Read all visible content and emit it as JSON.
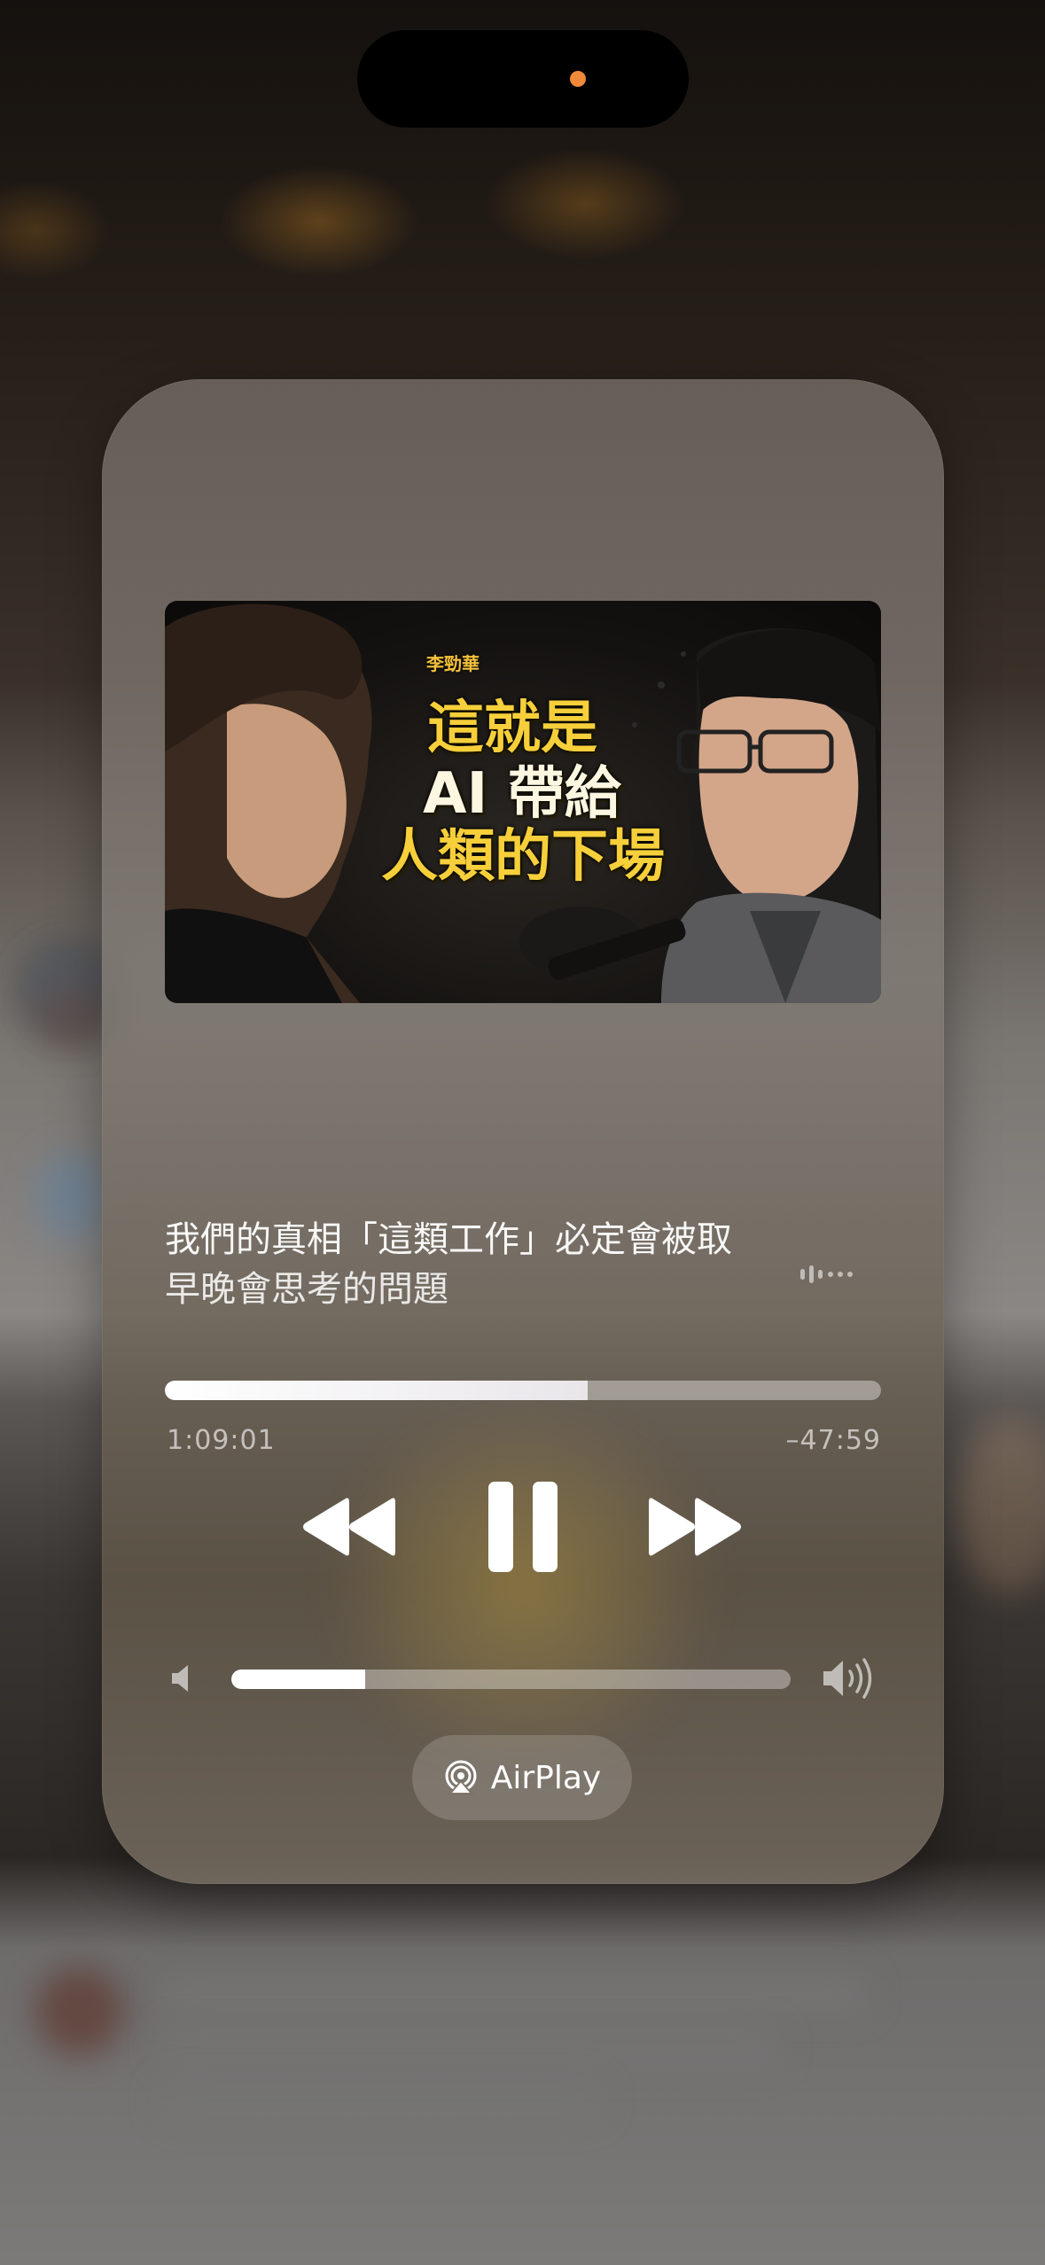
{
  "artwork": {
    "name_tag": "李勁華",
    "headline_line1": "這就是",
    "headline_line2": "AI 帶給",
    "headline_line3": "人類的下場"
  },
  "track": {
    "title": "我們的真相「這類工作」必定會被取",
    "subtitle": "早晚會思考的問題"
  },
  "playback": {
    "elapsed": "1:09:01",
    "remaining": "–47:59",
    "progress_fraction": 0.59
  },
  "volume": {
    "level_fraction": 0.24
  },
  "airplay": {
    "label": "AirPlay"
  },
  "icons": {
    "rewind": "rewind-icon",
    "pause": "pause-icon",
    "forward": "fast-forward-icon",
    "volume_low": "speaker-low-icon",
    "volume_high": "speaker-high-icon",
    "airplay": "airplay-icon",
    "waveform": "waveform-icon"
  },
  "colors": {
    "accent_yellow": "#f6cf3a",
    "privacy_dot": "#f08a3a"
  }
}
